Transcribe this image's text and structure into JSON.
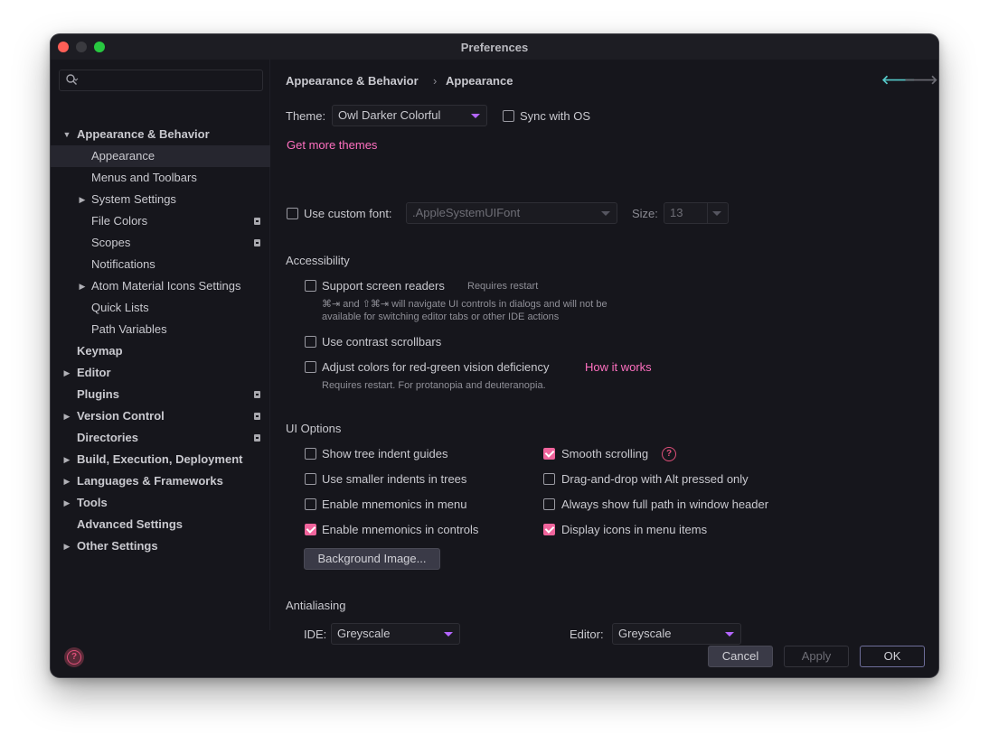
{
  "window": {
    "title": "Preferences"
  },
  "search": {
    "placeholder": ""
  },
  "sidebar": {
    "items": [
      {
        "label": "Appearance & Behavior",
        "expanded": true
      },
      {
        "label": "Appearance"
      },
      {
        "label": "Menus and Toolbars"
      },
      {
        "label": "System Settings"
      },
      {
        "label": "File Colors"
      },
      {
        "label": "Scopes"
      },
      {
        "label": "Notifications"
      },
      {
        "label": "Atom Material Icons Settings"
      },
      {
        "label": "Quick Lists"
      },
      {
        "label": "Path Variables"
      },
      {
        "label": "Keymap"
      },
      {
        "label": "Editor"
      },
      {
        "label": "Plugins"
      },
      {
        "label": "Version Control"
      },
      {
        "label": "Directories"
      },
      {
        "label": "Build, Execution, Deployment"
      },
      {
        "label": "Languages & Frameworks"
      },
      {
        "label": "Tools"
      },
      {
        "label": "Advanced Settings"
      },
      {
        "label": "Other Settings"
      }
    ],
    "selected": "Appearance"
  },
  "breadcrumb": {
    "parent": "Appearance & Behavior",
    "separator": "›",
    "current": "Appearance"
  },
  "nav": {
    "back_icon": "arrow-left-icon",
    "forward_icon": "arrow-right-icon",
    "back_color": "#55c8c8",
    "forward_color": "#6b6b73"
  },
  "theme": {
    "label": "Theme:",
    "value": "Owl Darker Colorful",
    "sync_label": "Sync with OS",
    "sync_checked": false,
    "more_link": "Get more themes"
  },
  "font": {
    "custom_label": "Use custom font:",
    "custom_checked": false,
    "font_value": ".AppleSystemUIFont",
    "size_label": "Size:",
    "size_value": "13"
  },
  "accessibility": {
    "title": "Accessibility",
    "screen_readers_label": "Support screen readers",
    "screen_readers_checked": false,
    "screen_readers_note": "Requires restart",
    "screen_readers_hint_1": "⌘⇥ and ⇧⌘⇥ will navigate UI controls in dialogs and will not be",
    "screen_readers_hint_2": "available for switching editor tabs or other IDE actions",
    "contrast_label": "Use contrast scrollbars",
    "contrast_checked": false,
    "redgreen_label": "Adjust colors for red-green vision deficiency",
    "redgreen_checked": false,
    "redgreen_link": "How it works",
    "redgreen_hint": "Requires restart. For protanopia and deuteranopia."
  },
  "ui_options": {
    "title": "UI Options",
    "left": [
      {
        "label": "Show tree indent guides",
        "checked": false
      },
      {
        "label": "Use smaller indents in trees",
        "checked": false
      },
      {
        "label": "Enable mnemonics in menu",
        "checked": false
      },
      {
        "label": "Enable mnemonics in controls",
        "checked": true
      }
    ],
    "right": [
      {
        "label": "Smooth scrolling",
        "checked": true
      },
      {
        "label": "Drag-and-drop with Alt pressed only",
        "checked": false
      },
      {
        "label": "Always show full path in window header",
        "checked": false
      },
      {
        "label": "Display icons in menu items",
        "checked": true
      }
    ],
    "background_button": "Background Image..."
  },
  "antialiasing": {
    "title": "Antialiasing",
    "ide_label": "IDE:",
    "ide_value": "Greyscale",
    "editor_label": "Editor:",
    "editor_value": "Greyscale"
  },
  "footer": {
    "cancel": "Cancel",
    "apply": "Apply",
    "ok": "OK"
  },
  "colors": {
    "accent_pink": "#ff70c0",
    "checkbox_checked": "#f0649c",
    "combo_arrow": "#b466ff",
    "background": "#16161c"
  }
}
